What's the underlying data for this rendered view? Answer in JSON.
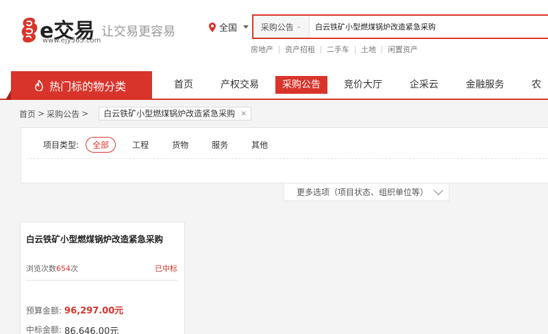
{
  "header": {
    "logo_text": "e交易",
    "logo_url": "www.ejy365.com",
    "slogan": "让交易更容易",
    "region": "全国",
    "search": {
      "category": "采购公告",
      "value": "白云铁矿小型燃煤锅炉改造紧急采购"
    },
    "hot_links": [
      "房地产",
      "资产招租",
      "二手车",
      "土地",
      "闲置资产"
    ]
  },
  "nav": {
    "category_tab": "热门标的物分类",
    "items": [
      "首页",
      "产权交易",
      "采购公告",
      "竞价大厅",
      "企采云",
      "金融服务",
      "农"
    ],
    "active_index": 2
  },
  "breadcrumb": {
    "home": "首页",
    "section": "采购公告",
    "sep": ">",
    "tag": "白云铁矿小型燃煤锅炉改造紧急采购",
    "tag_close": "×"
  },
  "filter": {
    "label": "项目类型:",
    "options": [
      "全部",
      "工程",
      "货物",
      "服务",
      "其他"
    ],
    "selected_index": 0,
    "more_label": "更多选项（项目状态、组织单位等）"
  },
  "card": {
    "title": "白云铁矿小型燃煤锅炉改造紧急采购",
    "views_prefix": "浏览次数",
    "views": "654",
    "views_suffix": "次",
    "status": "已中标",
    "budget_label": "预算金额:",
    "budget": "96,297.00元",
    "bid_label": "中标金额:",
    "bid": "86,646.00元"
  },
  "colors": {
    "accent": "#d9342b"
  }
}
